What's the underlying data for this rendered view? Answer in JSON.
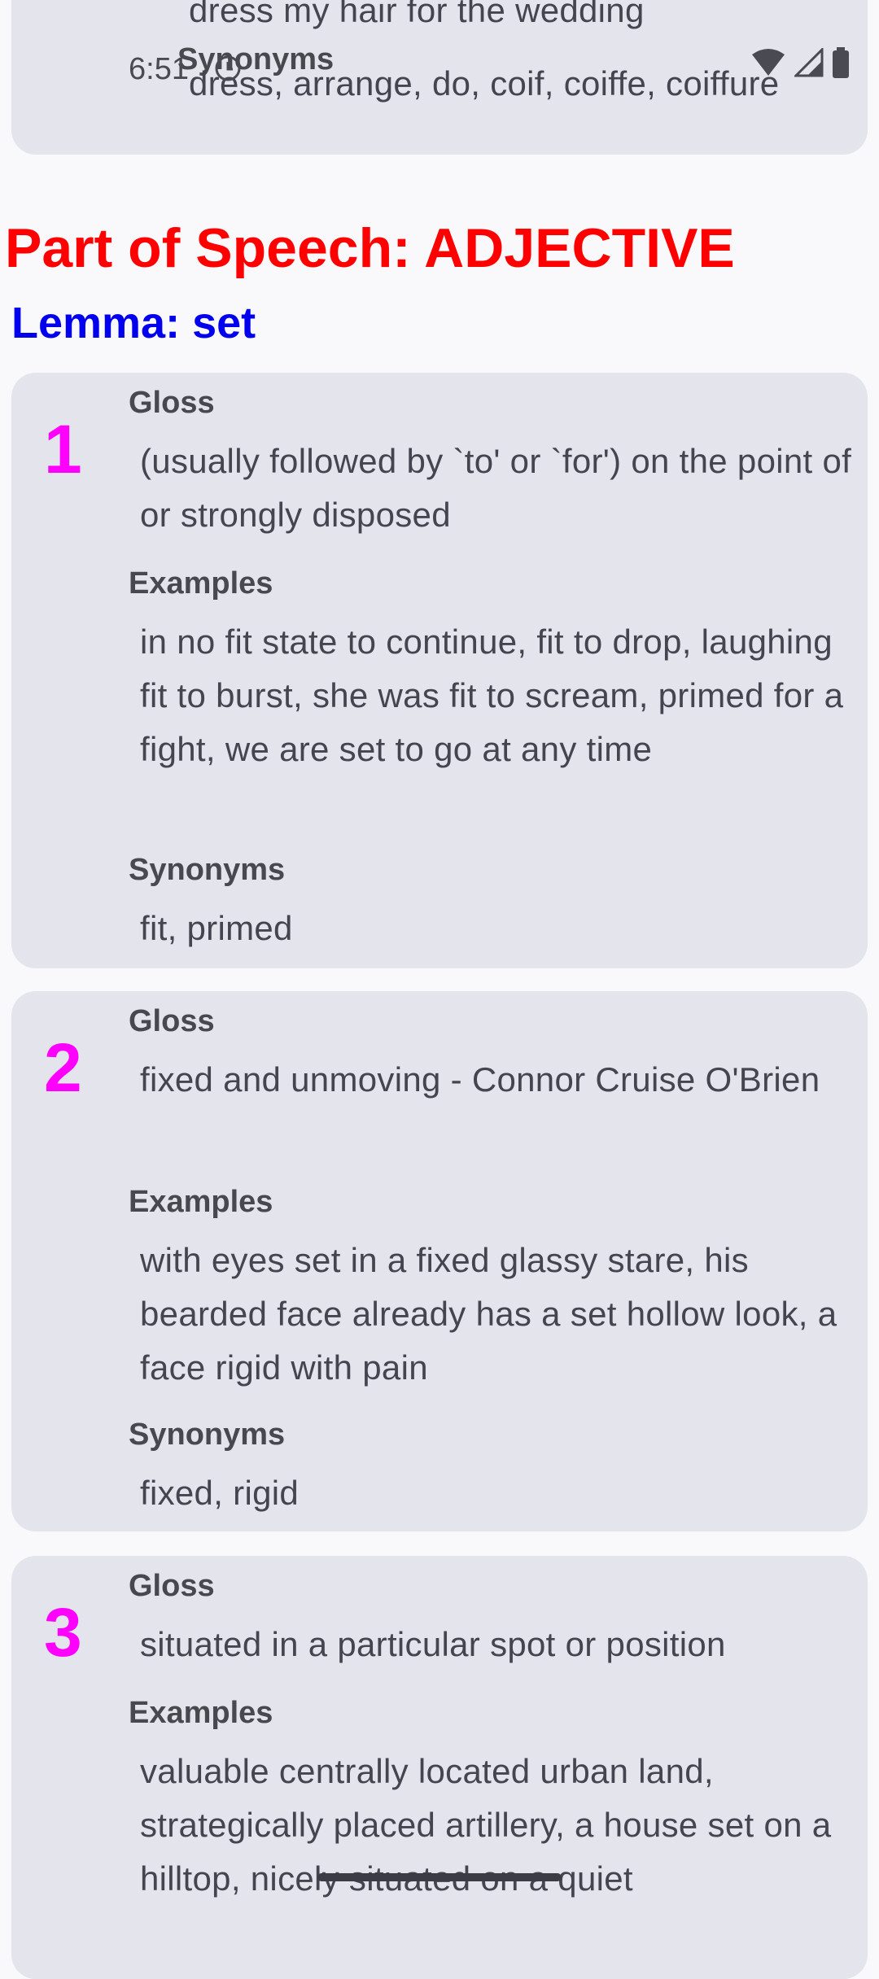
{
  "status_bar": {
    "time": "6:51"
  },
  "top_card": {
    "cut_text": "dress my hair for the wedding",
    "synonyms_label": "Synonyms",
    "synonyms": "dress, arrange, do, coif, coiffe, coiffure"
  },
  "part_of_speech": "Part of Speech: ADJECTIVE",
  "lemma": "Lemma: set",
  "senses": [
    {
      "number": "1",
      "gloss_label": "Gloss",
      "gloss": "(usually followed by `to' or `for') on the point of or strongly disposed",
      "examples_label": "Examples",
      "examples": "in no fit state to continue, fit to drop, laughing fit to burst, she was fit to scream, primed for a fight, we are set to go at any time",
      "synonyms_label": "Synonyms",
      "synonyms": "fit, primed"
    },
    {
      "number": "2",
      "gloss_label": "Gloss",
      "gloss": "fixed and unmoving  - Connor Cruise O'Brien",
      "examples_label": "Examples",
      "examples": "with eyes set in a fixed glassy stare, his bearded face already has a set hollow look, a face rigid with pain",
      "synonyms_label": "Synonyms",
      "synonyms": "fixed, rigid"
    },
    {
      "number": "3",
      "gloss_label": "Gloss",
      "gloss": "situated in a particular spot or position",
      "examples_label": "Examples",
      "examples": "valuable centrally located urban land, strategically placed artillery, a house set on a hilltop, nicely situated on a quiet"
    }
  ],
  "colors": {
    "pos_heading": "#ff0000",
    "lemma_heading": "#0000ee",
    "sense_number": "#ff00ff",
    "card_bg": "#e4e4ed"
  },
  "icons": [
    "wifi-icon",
    "cell-signal-icon",
    "battery-icon",
    "sync-icon"
  ]
}
